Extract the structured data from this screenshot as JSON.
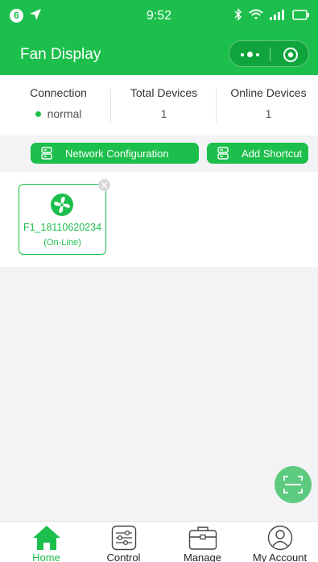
{
  "status_bar": {
    "badge": "6",
    "time": "9:52"
  },
  "header": {
    "title": "Fan Display"
  },
  "stats": [
    {
      "label": "Connection",
      "value": "normal"
    },
    {
      "label": "Total Devices",
      "value": "1"
    },
    {
      "label": "Online Devices",
      "value": "1"
    }
  ],
  "actions": {
    "network_config": "Network Configuration",
    "add_shortcut": "Add Shortcut"
  },
  "devices": [
    {
      "name": "F1_18110620234",
      "status": "(On-Line)",
      "icon": "fan-icon"
    }
  ],
  "tabs": [
    {
      "label": "Home",
      "icon": "home-icon",
      "active": true
    },
    {
      "label": "Control",
      "icon": "sliders-icon",
      "active": false
    },
    {
      "label": "Manage",
      "icon": "briefcase-icon",
      "active": false
    },
    {
      "label": "My Account",
      "icon": "user-icon",
      "active": false
    }
  ],
  "colors": {
    "primary": "#1cbf4b",
    "fab": "#5dcb7f",
    "background": "#f3f3f5"
  }
}
